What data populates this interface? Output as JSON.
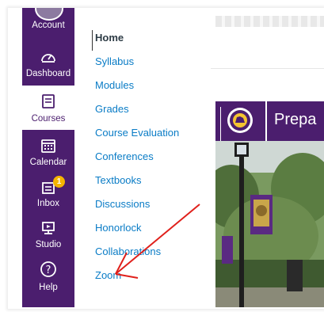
{
  "global_nav": {
    "items": [
      {
        "label": "Account",
        "icon": "account-icon"
      },
      {
        "label": "Dashboard",
        "icon": "dashboard-icon"
      },
      {
        "label": "Courses",
        "icon": "courses-icon",
        "active": true
      },
      {
        "label": "Calendar",
        "icon": "calendar-icon"
      },
      {
        "label": "Inbox",
        "icon": "inbox-icon",
        "badge": "1"
      },
      {
        "label": "Studio",
        "icon": "studio-icon"
      },
      {
        "label": "Help",
        "icon": "help-icon"
      }
    ]
  },
  "course_nav": {
    "items": [
      {
        "label": "Home",
        "current": true
      },
      {
        "label": "Syllabus"
      },
      {
        "label": "Modules"
      },
      {
        "label": "Grades"
      },
      {
        "label": "Course Evaluation"
      },
      {
        "label": "Conferences"
      },
      {
        "label": "Textbooks"
      },
      {
        "label": "Discussions"
      },
      {
        "label": "Honorlock"
      },
      {
        "label": "Collaborations"
      },
      {
        "label": "Zoom"
      }
    ]
  },
  "banner": {
    "title": "Prepa"
  },
  "colors": {
    "brand_purple": "#4b1e6e",
    "link_blue": "#0a7cc6",
    "badge_gold": "#f4b400",
    "arrow_red": "#e0201b"
  }
}
